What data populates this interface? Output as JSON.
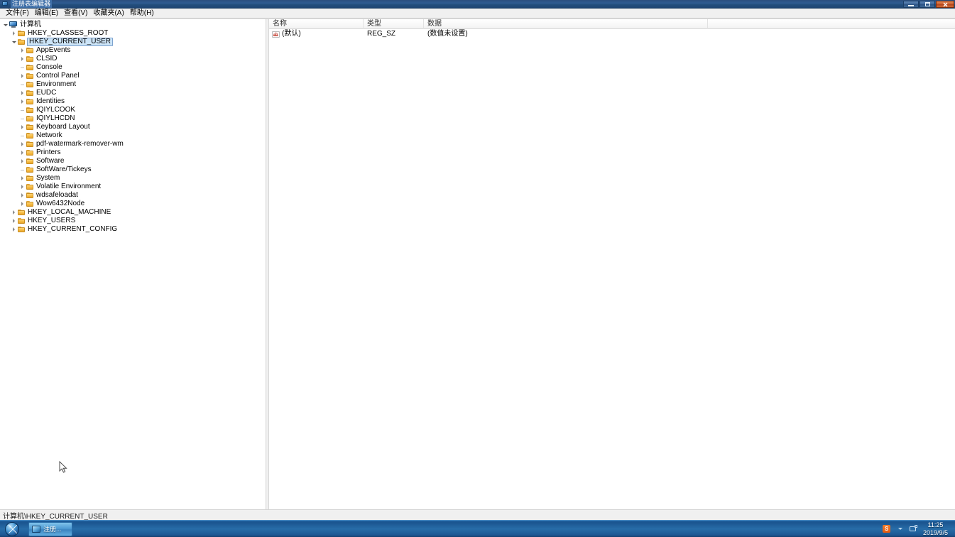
{
  "window": {
    "title": "注册表编辑器",
    "icon": "registry-editor-icon",
    "controls": {
      "minimize": "最小化",
      "maximize": "最大化",
      "close": "关闭"
    }
  },
  "menubar": {
    "items": [
      {
        "label": "文件(F)",
        "name": "menu-file"
      },
      {
        "label": "编辑(E)",
        "name": "menu-edit"
      },
      {
        "label": "查看(V)",
        "name": "menu-view"
      },
      {
        "label": "收藏夹(A)",
        "name": "menu-favorites"
      },
      {
        "label": "帮助(H)",
        "name": "menu-help"
      }
    ]
  },
  "tree": {
    "root": {
      "label": "计算机",
      "icon": "computer-icon",
      "expanded": true
    },
    "nodes": [
      {
        "label": "HKEY_CLASSES_ROOT",
        "level": 1,
        "state": "collapsed",
        "selected": false
      },
      {
        "label": "HKEY_CURRENT_USER",
        "level": 1,
        "state": "expanded",
        "selected": true
      },
      {
        "label": "AppEvents",
        "level": 2,
        "state": "collapsed",
        "selected": false
      },
      {
        "label": "CLSID",
        "level": 2,
        "state": "collapsed",
        "selected": false
      },
      {
        "label": "Console",
        "level": 2,
        "state": "leaf",
        "selected": false
      },
      {
        "label": "Control Panel",
        "level": 2,
        "state": "collapsed",
        "selected": false
      },
      {
        "label": "Environment",
        "level": 2,
        "state": "leaf",
        "selected": false
      },
      {
        "label": "EUDC",
        "level": 2,
        "state": "collapsed",
        "selected": false
      },
      {
        "label": "Identities",
        "level": 2,
        "state": "collapsed",
        "selected": false
      },
      {
        "label": "IQIYLCOOK",
        "level": 2,
        "state": "leaf",
        "selected": false
      },
      {
        "label": "IQIYLHCDN",
        "level": 2,
        "state": "leaf",
        "selected": false
      },
      {
        "label": "Keyboard Layout",
        "level": 2,
        "state": "collapsed",
        "selected": false
      },
      {
        "label": "Network",
        "level": 2,
        "state": "leaf",
        "selected": false
      },
      {
        "label": "pdf-watermark-remover-wm",
        "level": 2,
        "state": "collapsed",
        "selected": false
      },
      {
        "label": "Printers",
        "level": 2,
        "state": "collapsed",
        "selected": false
      },
      {
        "label": "Software",
        "level": 2,
        "state": "collapsed",
        "selected": false
      },
      {
        "label": "SoftWare/Tickeys",
        "level": 2,
        "state": "leaf",
        "selected": false
      },
      {
        "label": "System",
        "level": 2,
        "state": "collapsed",
        "selected": false
      },
      {
        "label": "Volatile Environment",
        "level": 2,
        "state": "collapsed",
        "selected": false
      },
      {
        "label": "wdsafeloadat",
        "level": 2,
        "state": "collapsed",
        "selected": false
      },
      {
        "label": "Wow6432Node",
        "level": 2,
        "state": "collapsed",
        "selected": false
      },
      {
        "label": "HKEY_LOCAL_MACHINE",
        "level": 1,
        "state": "collapsed",
        "selected": false
      },
      {
        "label": "HKEY_USERS",
        "level": 1,
        "state": "collapsed",
        "selected": false
      },
      {
        "label": "HKEY_CURRENT_CONFIG",
        "level": 1,
        "state": "collapsed",
        "selected": false
      }
    ]
  },
  "list": {
    "columns": [
      {
        "label": "名称",
        "name": "column-name"
      },
      {
        "label": "类型",
        "name": "column-type"
      },
      {
        "label": "数据",
        "name": "column-data"
      }
    ],
    "rows": [
      {
        "name": "(默认)",
        "type": "REG_SZ",
        "data": "(数值未设置)",
        "icon": "string-value-icon"
      }
    ]
  },
  "statusbar": {
    "path": "计算机\\HKEY_CURRENT_USER"
  },
  "taskbar": {
    "start": "开始",
    "buttons": [
      {
        "label": "注册...",
        "name": "taskbar-regedit"
      }
    ],
    "tray": {
      "icons": [
        {
          "name": "sogou-input-icon"
        },
        {
          "name": "show-hidden-icons-arrow"
        },
        {
          "name": "network-icon"
        }
      ],
      "time": "11:25",
      "date": "2019/9/5"
    }
  },
  "colors": {
    "titlebar": "#2f5c92",
    "selection": "#cce4f7",
    "folder": "#f8c04a",
    "taskbar": "#276da8",
    "close_button": "#cc5a2a"
  }
}
